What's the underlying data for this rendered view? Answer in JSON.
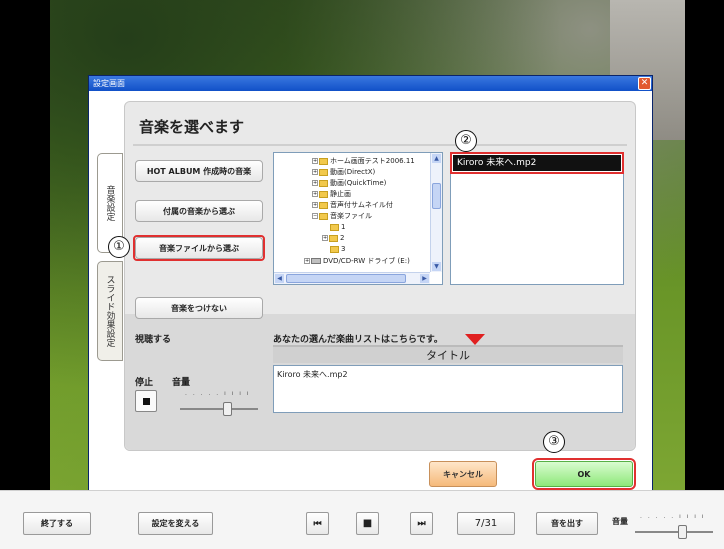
{
  "window": {
    "title": "設定画面",
    "close_glyph": "✕"
  },
  "tabs": [
    {
      "label": "音楽設定",
      "active": true
    },
    {
      "label": "スライド効果設定",
      "active": false
    }
  ],
  "panel": {
    "title": "音楽を選べます",
    "buttons": {
      "hot_album": "HOT ALBUM 作成時の音楽",
      "bundled": "付属の音楽から選ぶ",
      "from_file": "音楽ファイルから選ぶ",
      "no_music": "音楽をつけない"
    }
  },
  "annotations": {
    "one": "①",
    "two": "②",
    "three": "③"
  },
  "tree": {
    "items": [
      "ホーム画面テスト2006.11",
      "動画(DirectX)",
      "動画(QuickTime)",
      "静止画",
      "音声付サムネイル付",
      "音楽ファイル",
      "1",
      "2",
      "3",
      "DVD/CD-RW ドライブ (E:)"
    ]
  },
  "file_list": {
    "selected": "Kiroro 未来へ.mp2"
  },
  "preview": {
    "label": "視聴する",
    "stop_label": "停止",
    "volume_label": "音量",
    "volume_ticks": ". . . . . ı ı ı ı",
    "volume_level": 0.55
  },
  "song_list": {
    "caption": "あなたの選んだ楽曲リストはこちらです。",
    "header": "タイトル",
    "items": [
      "Kiroro 未来へ.mp2"
    ]
  },
  "dialog_buttons": {
    "cancel": "キャンセル",
    "ok": "OK"
  },
  "toolbar": {
    "exit": "終了する",
    "change_settings": "設定を変える",
    "prev_glyph": "⏮",
    "stop_glyph": "■",
    "next_glyph": "⏭",
    "page": "7/31",
    "sound": "音を出す",
    "volume_label": "音量",
    "volume_ticks": ". . . . . ı ı ı ı",
    "volume_level": 0.55
  },
  "colors": {
    "ok_green": "#8ee87a",
    "cancel_orange": "#f5b97a",
    "highlight_red": "#e03030"
  }
}
